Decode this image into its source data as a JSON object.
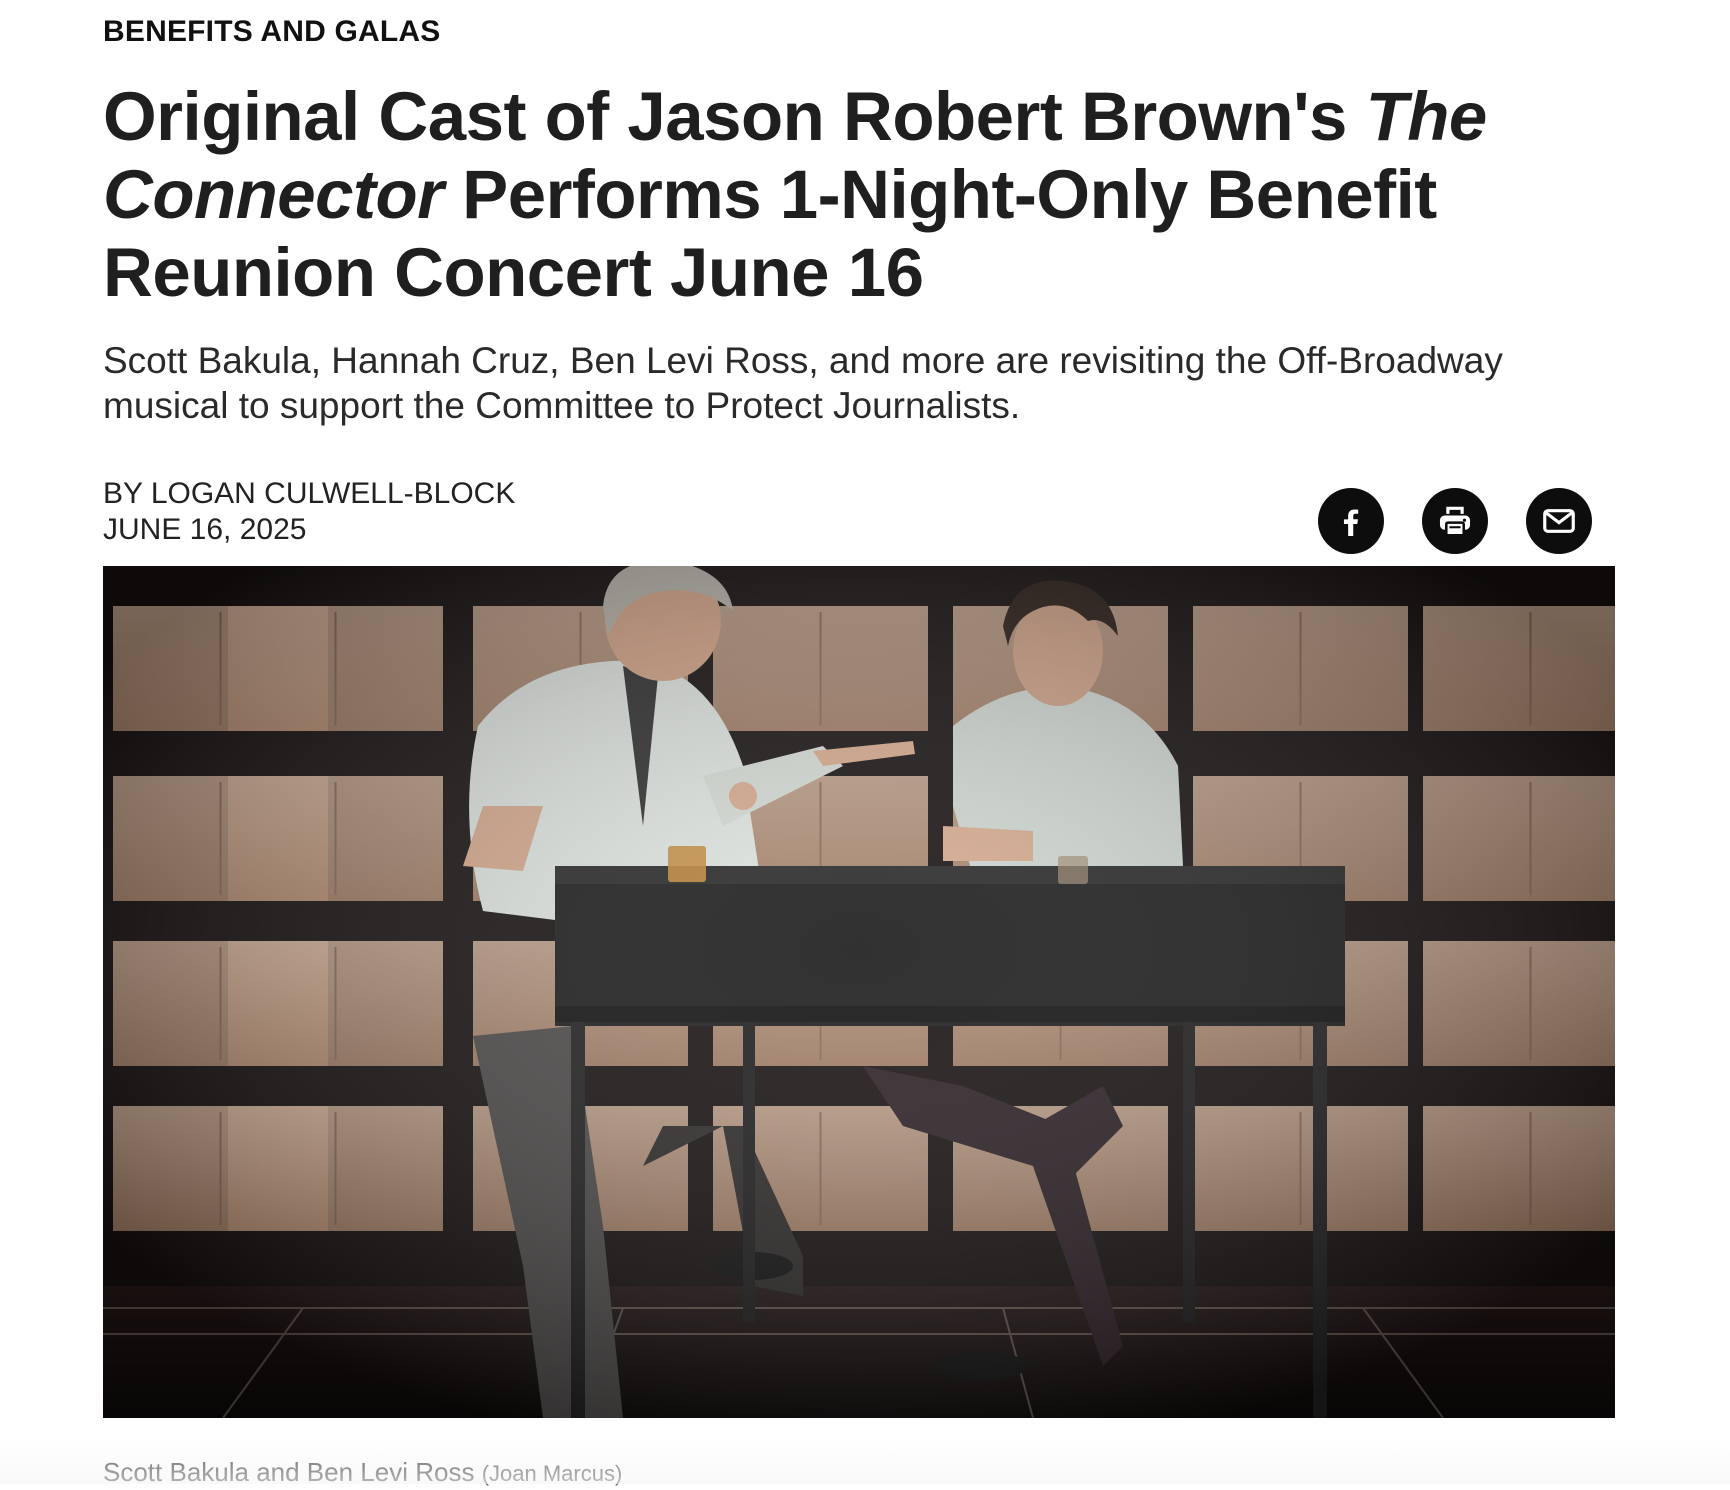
{
  "article": {
    "category": "BENEFITS AND GALAS",
    "headline": {
      "part1": "Original Cast of Jason Robert Brown's ",
      "italic1": "The Connector",
      "part2": " Performs 1-Night-Only Benefit Reunion Concert June 16"
    },
    "dek": "Scott Bakula, Hannah Cruz, Ben Levi Ross, and more are revisiting the Off-Broadway musical to support the Committee to Protect Journalists.",
    "byline": "BY LOGAN CULWELL-BLOCK",
    "date": "JUNE 16, 2025",
    "caption": "Scott Bakula and Ben Levi Ross",
    "photo_credit": "(Joan Marcus)"
  },
  "share": [
    {
      "name": "facebook-icon"
    },
    {
      "name": "print-icon"
    },
    {
      "name": "email-icon"
    }
  ],
  "colors": {
    "text": "#1f1f1f",
    "icon_bg": "#0d0d0d",
    "stage_back": "#141010",
    "newspaper_page": "#c9a88f"
  }
}
